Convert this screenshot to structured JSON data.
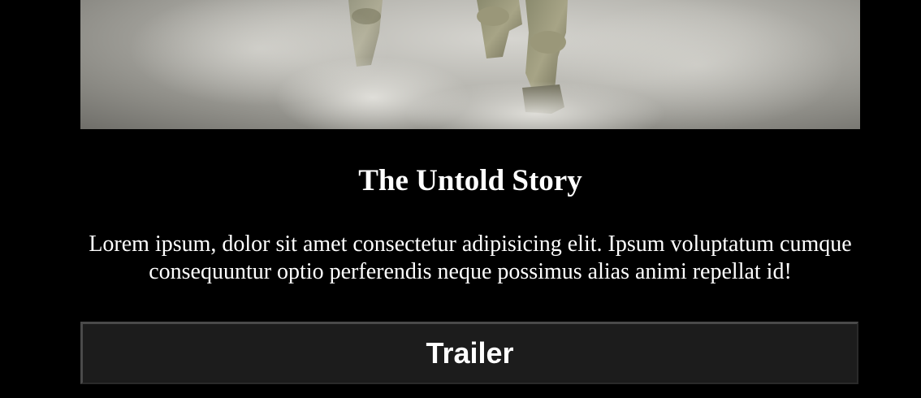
{
  "hero": {
    "image_name": "soldiers-walking-through-dust"
  },
  "movie": {
    "title": "The Untold Story",
    "description": "Lorem ipsum, dolor sit amet consectetur adipisicing elit. Ipsum voluptatum cumque consequuntur optio perferendis neque possimus alias animi repellat id!"
  },
  "trailer_button": {
    "label": "Trailer"
  },
  "colors": {
    "background": "#000000",
    "text": "#ffffff",
    "button_bg": "#1c1c1c"
  }
}
